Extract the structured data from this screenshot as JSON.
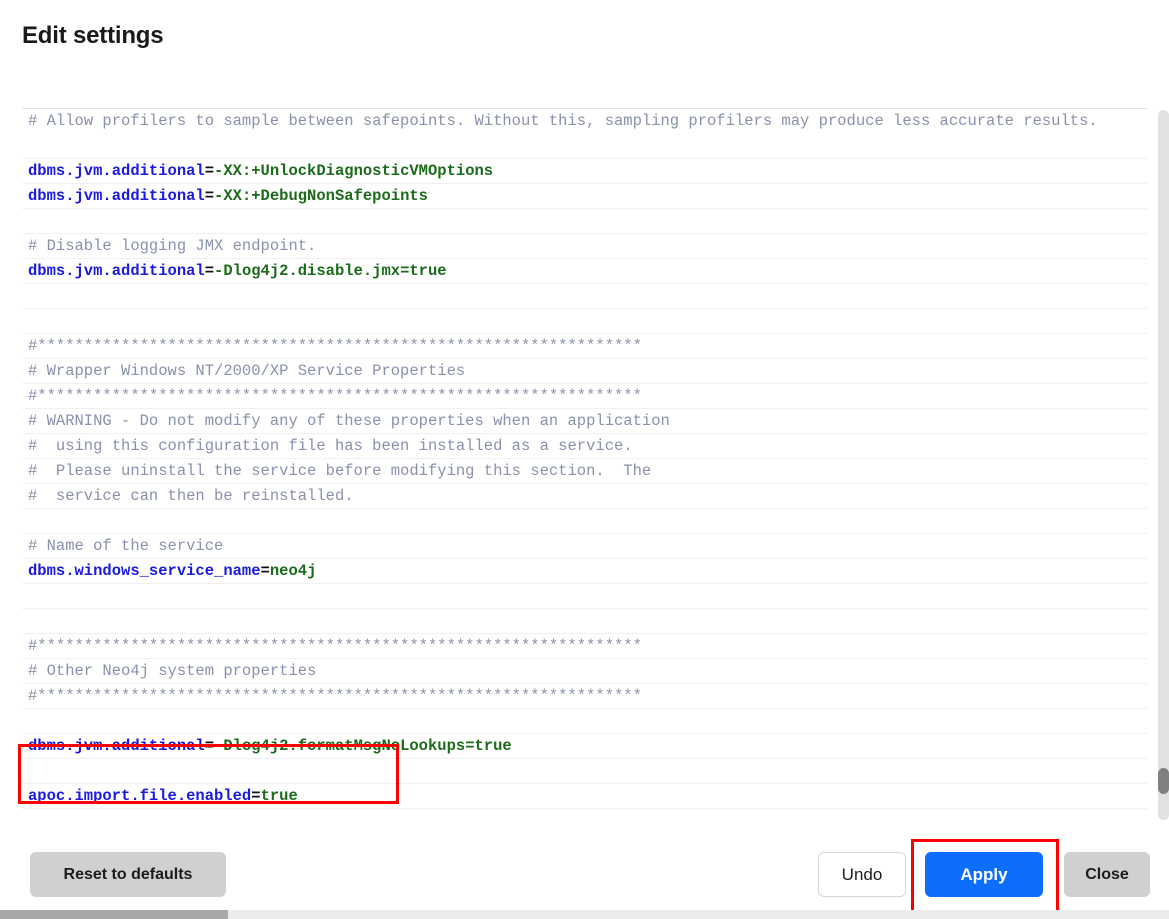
{
  "dialog": {
    "title": "Edit settings"
  },
  "editor": {
    "lines": [
      {
        "type": "comment",
        "text": "# Allow profilers to sample between safepoints. Without this, sampling profilers may produce less accurate results.",
        "wrapped": true
      },
      {
        "type": "prop",
        "key": "dbms.jvm.additional",
        "eq": "=",
        "value": "-XX:+UnlockDiagnosticVMOptions"
      },
      {
        "type": "prop",
        "key": "dbms.jvm.additional",
        "eq": "=",
        "value": "-XX:+DebugNonSafepoints"
      },
      {
        "type": "blank",
        "text": ""
      },
      {
        "type": "comment",
        "text": "# Disable logging JMX endpoint."
      },
      {
        "type": "prop",
        "key": "dbms.jvm.additional",
        "eq": "=",
        "value": "-Dlog4j2.disable.jmx=true"
      },
      {
        "type": "blank",
        "text": ""
      },
      {
        "type": "blank",
        "text": ""
      },
      {
        "type": "comment",
        "text": "#*****************************************************************"
      },
      {
        "type": "comment",
        "text": "# Wrapper Windows NT/2000/XP Service Properties"
      },
      {
        "type": "comment",
        "text": "#*****************************************************************"
      },
      {
        "type": "comment",
        "text": "# WARNING - Do not modify any of these properties when an application"
      },
      {
        "type": "comment",
        "text": "#  using this configuration file has been installed as a service."
      },
      {
        "type": "comment",
        "text": "#  Please uninstall the service before modifying this section.  The"
      },
      {
        "type": "comment",
        "text": "#  service can then be reinstalled."
      },
      {
        "type": "blank",
        "text": ""
      },
      {
        "type": "comment",
        "text": "# Name of the service"
      },
      {
        "type": "prop",
        "key": "dbms.windows_service_name",
        "eq": "=",
        "value": "neo4j"
      },
      {
        "type": "blank",
        "text": ""
      },
      {
        "type": "blank",
        "text": ""
      },
      {
        "type": "comment",
        "text": "#*****************************************************************"
      },
      {
        "type": "comment",
        "text": "# Other Neo4j system properties"
      },
      {
        "type": "comment",
        "text": "#*****************************************************************"
      },
      {
        "type": "blank",
        "text": ""
      },
      {
        "type": "prop",
        "key": "dbms.jvm.additional",
        "eq": "=",
        "value": "-Dlog4j2.formatMsgNoLookups=true"
      },
      {
        "type": "blank",
        "text": ""
      },
      {
        "type": "prop",
        "key": "apoc.import.file.enabled",
        "eq": "=",
        "value": "true"
      },
      {
        "type": "blank",
        "text": ""
      }
    ]
  },
  "footer": {
    "reset_label": "Reset to defaults",
    "undo_label": "Undo",
    "apply_label": "Apply",
    "close_label": "Close"
  },
  "colors": {
    "key": "#1a1ae0",
    "value": "#1b6b1b",
    "comment": "#8a91ab",
    "apply_button": "#0d6efd",
    "annotation": "#ff0000",
    "gray_button": "#d0d0d2"
  }
}
